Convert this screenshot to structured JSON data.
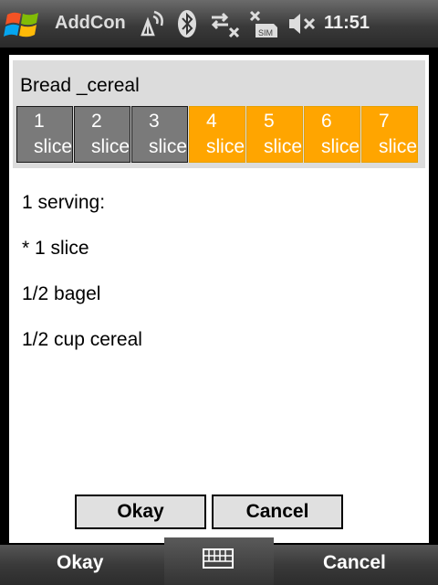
{
  "titlebar": {
    "app_title": "AddCon",
    "clock": "11:51",
    "icons": [
      "windows-start-icon",
      "signal-antenna-icon",
      "bluetooth-icon",
      "data-no-connection-icon",
      "no-sim-icon",
      "volume-muted-icon"
    ]
  },
  "category": {
    "title": "Bread _cereal"
  },
  "slices": [
    {
      "number": "1",
      "unit": "slice",
      "selected": true
    },
    {
      "number": "2",
      "unit": "slice",
      "selected": true
    },
    {
      "number": "3",
      "unit": "slice",
      "selected": true
    },
    {
      "number": "4",
      "unit": "slice",
      "selected": false
    },
    {
      "number": "5",
      "unit": "slice",
      "selected": false
    },
    {
      "number": "6",
      "unit": "slice",
      "selected": false
    },
    {
      "number": "7",
      "unit": "slice",
      "selected": false
    }
  ],
  "serving_info": {
    "heading": "1 serving:",
    "lines": [
      "* 1 slice",
      "1/2 bagel",
      "1/2 cup cereal"
    ]
  },
  "dialog": {
    "okay_label": "Okay",
    "cancel_label": "Cancel"
  },
  "softkeys": {
    "left_label": "Okay",
    "right_label": "Cancel"
  },
  "colors": {
    "selected": "#7a7a7a",
    "unselected": "#ffa500"
  }
}
